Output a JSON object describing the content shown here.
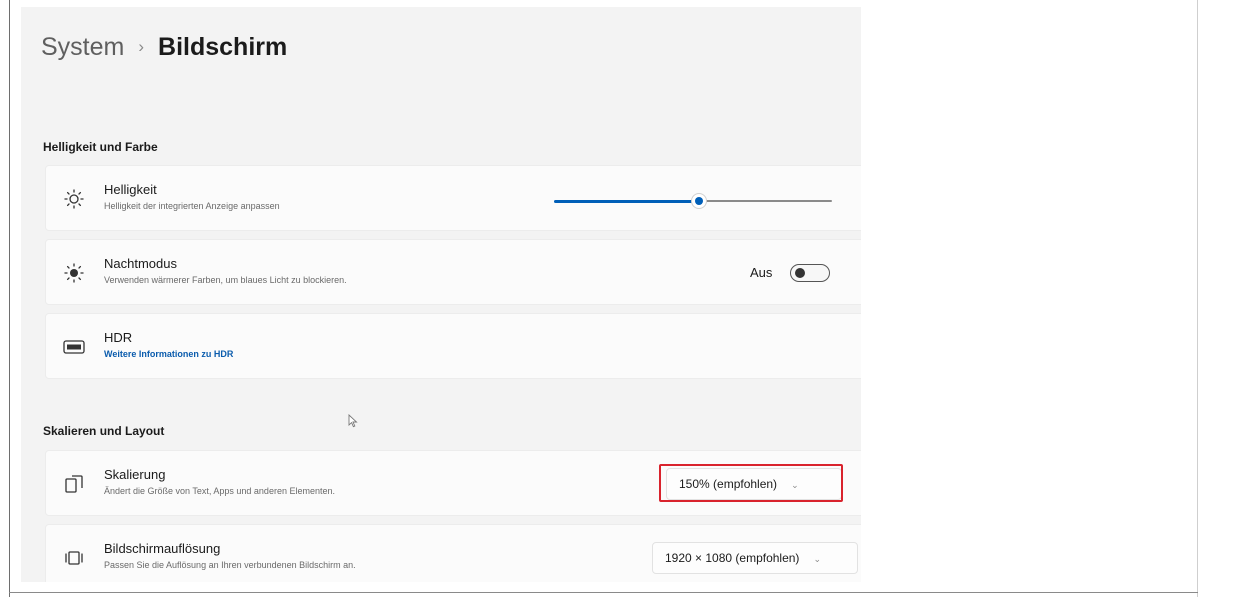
{
  "breadcrumb": {
    "parent": "System",
    "separator": "›",
    "current": "Bildschirm"
  },
  "sections": {
    "brightness_color": "Helligkeit und Farbe",
    "scale_layout": "Skalieren und Layout"
  },
  "settings": {
    "brightness": {
      "label": "Helligkeit",
      "description": "Helligkeit der integrierten Anzeige anpassen",
      "value_fraction": 0.52,
      "icon": "sun-icon"
    },
    "night_mode": {
      "label": "Nachtmodus",
      "description": "Verwenden wärmerer Farben, um blaues Licht zu blockieren.",
      "state": "Aus",
      "icon": "night-light-icon"
    },
    "hdr": {
      "label": "HDR",
      "link": "Weitere Informationen zu HDR",
      "icon": "hdr-icon"
    },
    "scaling": {
      "label": "Skalierung",
      "description": "Ändert die Größe von Text, Apps und anderen Elementen.",
      "value": "150% (empfohlen)",
      "icon": "scaling-icon"
    },
    "resolution": {
      "label": "Bildschirmauflösung",
      "description": "Passen Sie die Auflösung an Ihren verbundenen Bildschirm an.",
      "value": "1920 × 1080 (empfohlen)",
      "icon": "resolution-icon"
    }
  },
  "colors": {
    "accent": "#005fb8",
    "highlight": "#d9232d",
    "link": "#0b5cad"
  }
}
